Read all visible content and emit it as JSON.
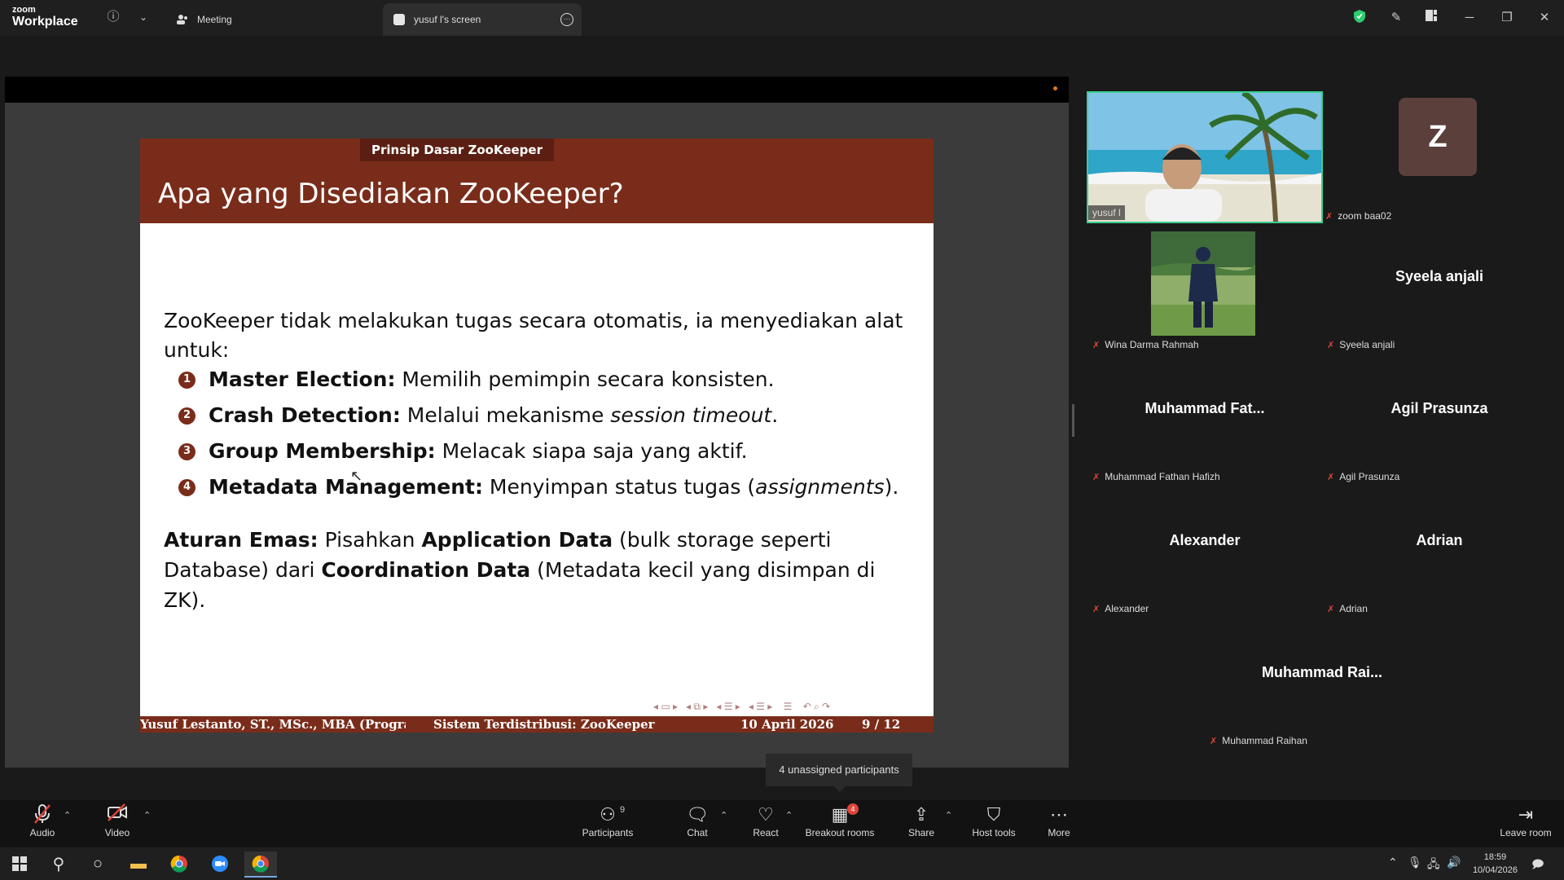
{
  "app": {
    "brand_top": "zoom",
    "brand_bottom": "Workplace"
  },
  "tabs": {
    "meeting": "Meeting",
    "screen": "yusuf l's screen"
  },
  "slide": {
    "section": "Prinsip Dasar ZooKeeper",
    "title": "Apa yang Disediakan ZooKeeper?",
    "intro": "ZooKeeper tidak melakukan tugas secara otomatis, ia menyediakan alat untuk:",
    "bullets": [
      {
        "num": "1",
        "term": "Master Election:",
        "text": " Memilih pemimpin secara konsisten.",
        "em": "",
        "tail": ""
      },
      {
        "num": "2",
        "term": "Crash Detection:",
        "text": " Melalui mekanisme ",
        "em": "session timeout",
        "tail": "."
      },
      {
        "num": "3",
        "term": "Group Membership:",
        "text": " Melacak siapa saja yang aktif.",
        "em": "",
        "tail": ""
      },
      {
        "num": "4",
        "term": "Metadata Management:",
        "text": " Menyimpan status tugas (",
        "em": "assignments",
        "tail": ")."
      }
    ],
    "rule": {
      "term": "Aturan Emas:",
      "p1": " Pisahkan ",
      "b1": "Application Data",
      "p2": " (bulk storage seperti Database) dari ",
      "b2": "Coordination Data",
      "p3": " (Metadata kecil yang disimpan di ZK)."
    },
    "footer": {
      "author": "Yusuf Lestanto, ST., MSc., MBA (Progra",
      "course": "Sistem Terdistribusi: ZooKeeper",
      "date": "10 April 2026",
      "page": "9 / 12"
    }
  },
  "gallery": {
    "tiles": [
      {
        "label": "yusuf l",
        "big": ""
      },
      {
        "label": "zoom baa02",
        "big": "",
        "avatar": "Z"
      },
      {
        "label": "Wina Darma Rahmah",
        "big": ""
      },
      {
        "label": "Syeela anjali",
        "big": "Syeela anjali"
      },
      {
        "label": "Muhammad Fathan Hafizh",
        "big": "Muhammad Fat..."
      },
      {
        "label": "Agil Prasunza",
        "big": "Agil Prasunza"
      },
      {
        "label": "Alexander",
        "big": "Alexander"
      },
      {
        "label": "Adrian",
        "big": "Adrian"
      },
      {
        "label": "Muhammad Raihan",
        "big": "Muhammad Rai..."
      }
    ]
  },
  "toast": "4 unassigned participants",
  "toolbar": {
    "audio": "Audio",
    "video": "Video",
    "participants": "Participants",
    "participants_count": "9",
    "chat": "Chat",
    "react": "React",
    "breakout": "Breakout rooms",
    "breakout_badge": "4",
    "share": "Share",
    "host_tools": "Host tools",
    "more": "More",
    "leave": "Leave room"
  },
  "taskbar": {
    "time": "18:59",
    "date": "10/04/2026"
  },
  "colors": {
    "slide_header": "#7a2c1a",
    "active_speaker": "#3ccf8e",
    "mic_off": "#e0443a"
  }
}
